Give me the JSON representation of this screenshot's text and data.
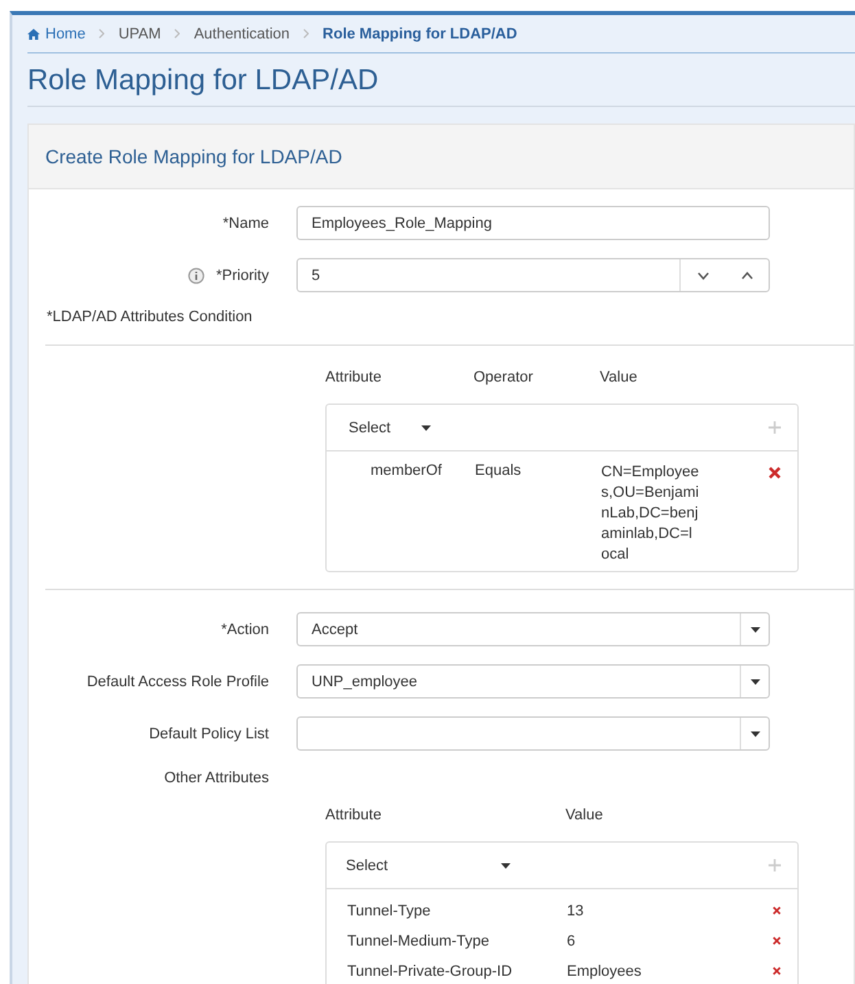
{
  "breadcrumb": [
    {
      "label": "Home",
      "kind": "home"
    },
    {
      "label": "UPAM",
      "kind": "plain"
    },
    {
      "label": "Authentication",
      "kind": "plain"
    },
    {
      "label": "Role Mapping for LDAP/AD",
      "kind": "current"
    }
  ],
  "page_title": "Role Mapping for LDAP/AD",
  "panel_title": "Create Role Mapping for LDAP/AD",
  "top_fields": [
    {
      "label": "*Name",
      "kind": "text",
      "value": "Employees_Role_Mapping",
      "info": false
    },
    {
      "label": "*Priority",
      "kind": "spinner",
      "value": "5",
      "info": true
    }
  ],
  "condition_label": "*LDAP/AD Attributes Condition",
  "condition_table": {
    "columns": [
      "Attribute",
      "Operator",
      "Value"
    ],
    "select": "Select",
    "rows": [
      {
        "cells": [
          "memberOf",
          "Equals",
          "CN=Employees,OU=BenjaminLab,DC=benjaminlab,DC=local"
        ]
      }
    ]
  },
  "bottom_fields": [
    {
      "label": "*Action",
      "kind": "select",
      "value": "Accept"
    },
    {
      "label": "Default Access Role Profile",
      "kind": "select",
      "value": "UNP_employee"
    },
    {
      "label": "Default Policy List",
      "kind": "select"
    }
  ],
  "other_label": "Other Attributes",
  "other_table": {
    "columns": [
      "Attribute",
      "Value"
    ],
    "select": "Select",
    "rows": [
      {
        "cells": [
          "Tunnel-Type",
          "13"
        ]
      },
      {
        "cells": [
          "Tunnel-Medium-Type",
          "6"
        ]
      },
      {
        "cells": [
          "Tunnel-Private-Group-ID",
          "Employees"
        ]
      }
    ]
  }
}
